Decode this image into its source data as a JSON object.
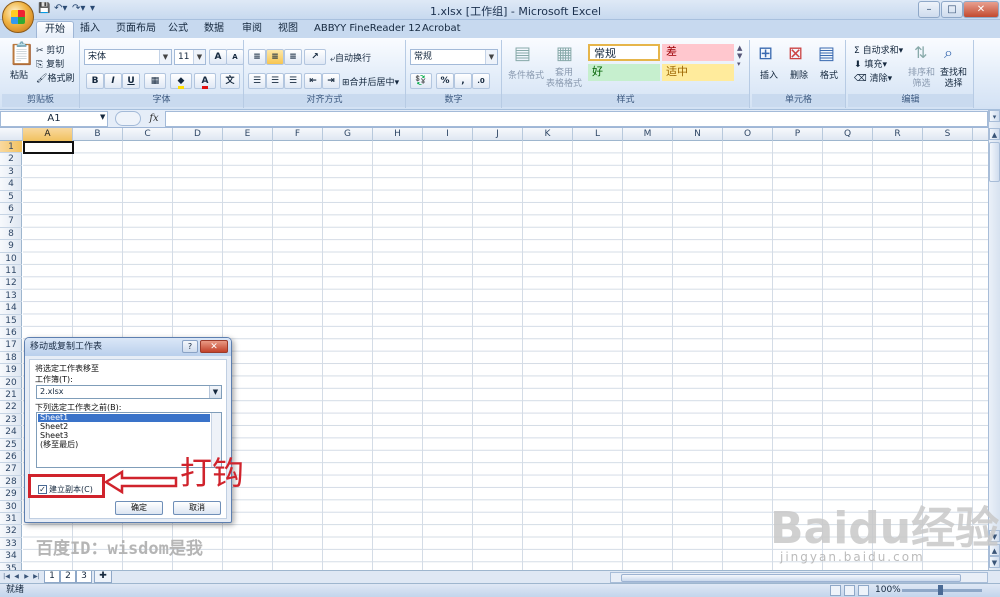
{
  "titlebar": {
    "title": "1.xlsx  [工作组] - Microsoft Excel",
    "min": "–",
    "max": "□",
    "close": "✕"
  },
  "tabs": [
    {
      "label": "开始"
    },
    {
      "label": "插入"
    },
    {
      "label": "页面布局"
    },
    {
      "label": "公式"
    },
    {
      "label": "数据"
    },
    {
      "label": "审阅"
    },
    {
      "label": "视图"
    },
    {
      "label": "ABBYY FineReader 12"
    },
    {
      "label": "Acrobat"
    }
  ],
  "ribbon": {
    "clipboard": {
      "paste": "粘贴",
      "cut": "剪切",
      "copy": "复制",
      "format_painter": "格式刷",
      "label": "剪贴板"
    },
    "font": {
      "name": "宋体",
      "size": "11",
      "bold": "B",
      "italic": "I",
      "underline": "U",
      "grow": "A",
      "shrink": "A",
      "fontcolor": "A",
      "label": "字体"
    },
    "align": {
      "wrap": "自动换行",
      "merge": "合并后居中",
      "label": "对齐方式"
    },
    "number": {
      "format": "常规",
      "percent": "%",
      "comma": ",",
      "label": "数字"
    },
    "styles": {
      "cond_format": "条件格式",
      "table_format": "套用\n表格格式",
      "s_normal": "常规",
      "s_bad": "差",
      "s_good": "好",
      "s_neutral": "适中",
      "label": "样式"
    },
    "cells": {
      "insert": "插入",
      "delete": "删除",
      "format": "格式",
      "label": "单元格"
    },
    "editing": {
      "autosum": "自动求和",
      "fill": "填充",
      "clear": "清除",
      "sort": "排序和\n筛选",
      "find": "查找和\n选择",
      "label": "编辑"
    }
  },
  "formula_bar": {
    "name_box": "A1",
    "fx": "fx",
    "value": ""
  },
  "columns": [
    "A",
    "B",
    "C",
    "D",
    "E",
    "F",
    "G",
    "H",
    "I",
    "J",
    "K",
    "L",
    "M",
    "N",
    "O",
    "P",
    "Q",
    "R",
    "S"
  ],
  "rows": [
    "1",
    "2",
    "3",
    "4",
    "5",
    "6",
    "7",
    "8",
    "9",
    "10",
    "11",
    "12",
    "13",
    "14",
    "15",
    "16",
    "17",
    "18",
    "19",
    "20",
    "21",
    "22",
    "23",
    "24",
    "25",
    "26",
    "27",
    "28",
    "29",
    "30",
    "31",
    "32",
    "33",
    "34",
    "35"
  ],
  "sheet_tabs": [
    "1",
    "2",
    "3"
  ],
  "status": {
    "ready": "就绪",
    "zoom": "100%"
  },
  "dialog": {
    "title": "移动或复制工作表",
    "help": "?",
    "close": "✕",
    "move_to": "将选定工作表移至",
    "workbook_label": "工作簿(T):",
    "workbook_value": "2.xlsx",
    "before_label": "下列选定工作表之前(B):",
    "sheets": [
      "Sheet1",
      "Sheet2",
      "Sheet3",
      "(移至最后)"
    ],
    "create_copy": "建立副本(C)",
    "create_copy_checked": "✓",
    "ok": "确定",
    "cancel": "取消"
  },
  "annotation": {
    "text": "打钩"
  },
  "watermarks": {
    "id": "百度ID：wisdom是我",
    "baidu": "Baidu经验",
    "url": "jingyan.baidu.com"
  },
  "colors": {
    "accent": "#d0232c",
    "selection": "#3a73c9",
    "ribbon": "#d3e2f4"
  }
}
